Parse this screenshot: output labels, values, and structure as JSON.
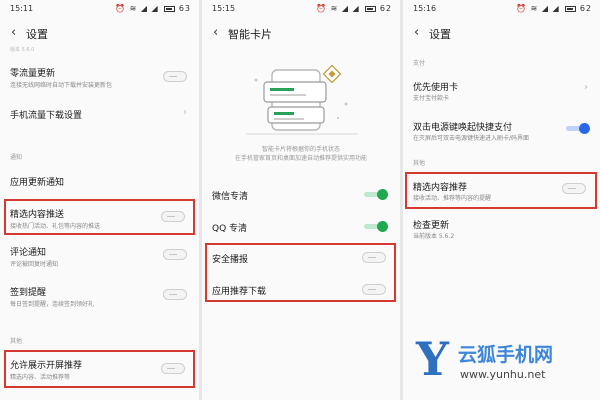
{
  "panel1": {
    "status_time": "15:11",
    "status_icons": "⏰ ≋ ◢ ◢",
    "battery": "63",
    "back_icon": "‹",
    "title": "设置",
    "version_text": "版本 5.6.0",
    "rows": [
      {
        "label": "零流量更新",
        "sub": "连接无线网络时自动下载并安装更新包",
        "toggle": "off"
      },
      {
        "label": "手机流量下载设置",
        "chevron": "›"
      }
    ],
    "section_notify": "通知",
    "notify_rows": [
      {
        "label": "应用更新通知"
      },
      {
        "label": "精选内容推送",
        "sub": "接收热门活动、礼包等内容的推送",
        "toggle": "off"
      },
      {
        "label": "评论通知",
        "sub": "评论被回复时通知",
        "toggle": "off"
      },
      {
        "label": "签到提醒",
        "sub": "每日签到提醒，连续签到领好礼",
        "toggle": "off"
      }
    ],
    "section_other": "其他",
    "other_rows": [
      {
        "label": "允许展示开屏推荐",
        "sub": "精选内容、活动推荐等",
        "toggle": "off"
      }
    ]
  },
  "panel2": {
    "status_time": "15:15",
    "status_icons": "⏰ ≋ ◢ ◢",
    "battery": "62",
    "back_icon": "‹",
    "title": "智能卡片",
    "desc_line1": "智能卡片将根据你的手机状态",
    "desc_line2": "在手机管家首页和桌面加速自动推荐提供实用功能",
    "rows": [
      {
        "label": "微信专清",
        "toggle": "on"
      },
      {
        "label": "QQ 专清",
        "toggle": "on"
      },
      {
        "label": "安全播报",
        "toggle": "off"
      },
      {
        "label": "应用推荐下载",
        "toggle": "off"
      }
    ]
  },
  "panel3": {
    "status_time": "15:16",
    "status_icons": "⏰ ≋ ◢ ◢",
    "battery": "62",
    "back_icon": "‹",
    "title": "设置",
    "section_pay": "支付",
    "pay_rows": [
      {
        "label": "优先使用卡",
        "sub": "支付宝付款卡",
        "chevron": "›"
      },
      {
        "label": "双击电源键唤起快捷支付",
        "sub": "在灭屏后可双击电源键快速进入刷卡/码界面",
        "toggle": "on"
      }
    ],
    "section_other": "其他",
    "other_rows": [
      {
        "label": "精选内容推荐",
        "sub": "接收活动、推荐等内容的提醒",
        "toggle": "off"
      },
      {
        "label": "检查更新",
        "sub": "当前版本 5.6.2"
      }
    ]
  },
  "watermark": {
    "logo_letter": "Y",
    "brand": "云狐手机网",
    "url": "www.yunhu.net"
  },
  "colors": {
    "highlight": "#d43a32",
    "toggle_green": "#1fa84f",
    "toggle_blue": "#2a68e8",
    "watermark_blue": "#3d86d9"
  }
}
